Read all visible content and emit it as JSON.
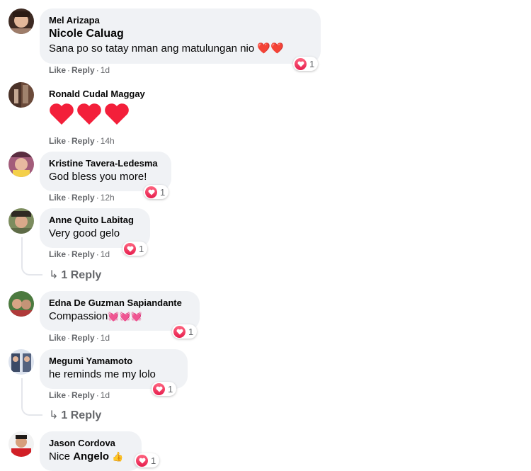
{
  "comments": [
    {
      "author": "Mel Arizapa",
      "mention": "Nicole Caluag",
      "text": "Sana po so tatay nman ang matulungan nio",
      "emoji": "❤️❤️",
      "like": "Like",
      "reply": "Reply",
      "time": "1d",
      "reactions": "1"
    },
    {
      "author": "Ronald Cudal Maggay",
      "like": "Like",
      "reply": "Reply",
      "time": "14h"
    },
    {
      "author": "Kristine Tavera-Ledesma",
      "text": "God bless you more!",
      "like": "Like",
      "reply": "Reply",
      "time": "12h",
      "reactions": "1"
    },
    {
      "author": "Anne Quito Labitag",
      "text": "Very good gelo",
      "like": "Like",
      "reply": "Reply",
      "time": "1d",
      "reactions": "1",
      "replies_label": "1 Reply"
    },
    {
      "author": "Edna De Guzman Sapiandante",
      "text": "Compassion",
      "emoji": "💓💓💓",
      "like": "Like",
      "reply": "Reply",
      "time": "1d",
      "reactions": "1"
    },
    {
      "author": "Megumi Yamamoto",
      "text": "he reminds me my lolo",
      "like": "Like",
      "reply": "Reply",
      "time": "1d",
      "reactions": "1",
      "replies_label": "1 Reply"
    },
    {
      "author": "Jason Cordova",
      "text": "Nice ",
      "mention": "Angelo",
      "emoji": "👍",
      "reactions": "1"
    }
  ],
  "colors": {
    "bubble": "#f0f2f5",
    "meta": "#65676b",
    "love": "#f33e58"
  }
}
